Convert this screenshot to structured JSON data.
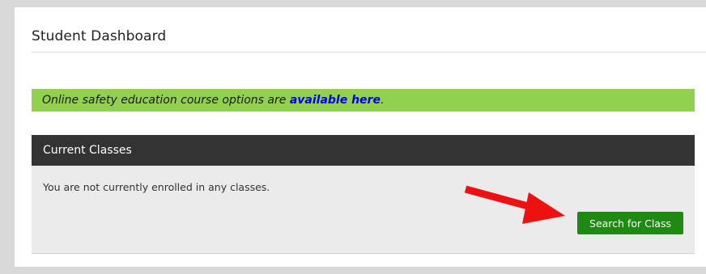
{
  "dashboard": {
    "title": "Student Dashboard"
  },
  "notice": {
    "text_before": "Online safety education course options are ",
    "link_text": "available here",
    "text_after": ".",
    "background_color": "#92d050",
    "link_color": "#0000ee"
  },
  "current_classes": {
    "header": "Current Classes",
    "empty_message": "You are not currently enrolled in any classes.",
    "search_button_label": "Search for Class",
    "button_color": "#1f8a12",
    "header_color": "#333333"
  },
  "annotation": {
    "icon": "red-arrow-icon",
    "color": "#ee1111"
  }
}
